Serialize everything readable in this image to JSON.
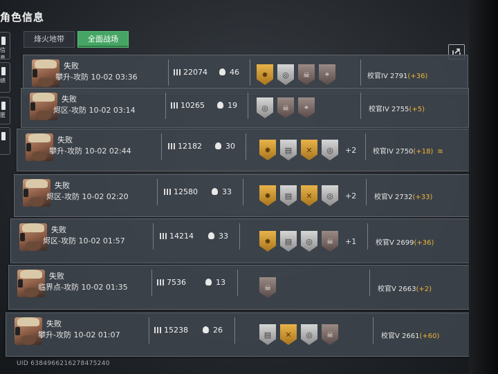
{
  "header": {
    "title": "角色信息"
  },
  "left_nav": [
    {
      "label": "信息"
    },
    {
      "label": "绩"
    },
    {
      "label": "匿"
    },
    {
      "label": ""
    }
  ],
  "tabs": [
    {
      "label": "烽火地带",
      "active": false
    },
    {
      "label": "全面战场",
      "active": true
    }
  ],
  "export_icon": "share-export-icon",
  "matches": [
    {
      "result": "失败",
      "mode": "攀升-攻防 10-02 03:36",
      "score": "22074",
      "kills": "46",
      "medals": [
        [
          "gold",
          "trophy"
        ],
        [
          "silver",
          "target"
        ],
        [
          "bronze",
          "skull"
        ],
        [
          "bronze",
          "crosshair"
        ]
      ],
      "more": "",
      "rank": "校官IV 2791",
      "delta": "(+36)",
      "rank_up": false
    },
    {
      "result": "失败",
      "mode": "烬区-攻防 10-02 03:14",
      "score": "10265",
      "kills": "19",
      "medals": [
        [
          "silver",
          "target"
        ],
        [
          "bronze",
          "skull"
        ],
        [
          "bronze",
          "crosshair"
        ]
      ],
      "more": "",
      "rank": "校官IV 2755",
      "delta": "(+5)",
      "rank_up": false
    },
    {
      "result": "失败",
      "mode": "攀升-攻防 10-02 02:44",
      "score": "12182",
      "kills": "30",
      "medals": [
        [
          "gold",
          "trophy"
        ],
        [
          "silver",
          "ammo"
        ],
        [
          "gold",
          "axe"
        ],
        [
          "silver",
          "target"
        ]
      ],
      "more": "+2",
      "rank": "校官IV 2750",
      "delta": "(+18)",
      "rank_up": true
    },
    {
      "result": "失败",
      "mode": "烬区-攻防 10-02 02:20",
      "score": "12580",
      "kills": "33",
      "medals": [
        [
          "gold",
          "trophy"
        ],
        [
          "silver",
          "ammo"
        ],
        [
          "gold",
          "axe"
        ],
        [
          "silver",
          "target"
        ]
      ],
      "more": "+2",
      "rank": "校官V 2732",
      "delta": "(+33)",
      "rank_up": false
    },
    {
      "result": "失败",
      "mode": "烬区-攻防 10-02 01:57",
      "score": "14214",
      "kills": "33",
      "medals": [
        [
          "gold",
          "trophy"
        ],
        [
          "silver",
          "ammo"
        ],
        [
          "silver",
          "target"
        ],
        [
          "bronze",
          "skull"
        ]
      ],
      "more": "+1",
      "rank": "校官V 2699",
      "delta": "(+36)",
      "rank_up": false
    },
    {
      "result": "失败",
      "mode": "临界点-攻防 10-02 01:35",
      "score": "7536",
      "kills": "13",
      "medals": [
        [
          "bronze",
          "skull"
        ]
      ],
      "more": "",
      "rank": "校官V 2663",
      "delta": "(+2)",
      "rank_up": false
    },
    {
      "result": "失败",
      "mode": "攀升-攻防 10-02 01:07",
      "score": "15238",
      "kills": "26",
      "medals": [
        [
          "silver",
          "ammo"
        ],
        [
          "gold",
          "axe"
        ],
        [
          "silver",
          "target"
        ],
        [
          "bronze",
          "skull"
        ]
      ],
      "more": "",
      "rank": "校官V 2661",
      "delta": "(+60)",
      "rank_up": false
    }
  ],
  "footer": {
    "uid": "UID 6384966216278475240"
  },
  "colors": {
    "accent_green": "#46a564",
    "delta_gold": "#f0b43a"
  }
}
